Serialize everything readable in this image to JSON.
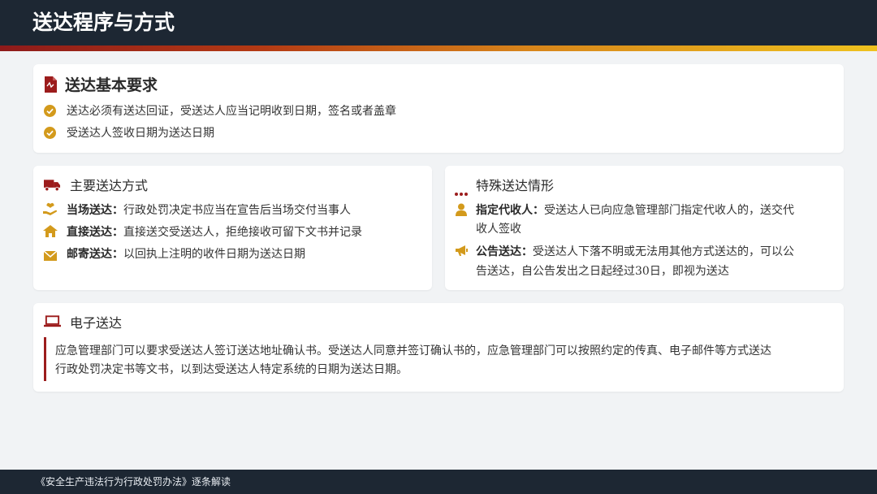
{
  "header": {
    "title": "送达程序与方式"
  },
  "basic": {
    "title": "送达基本要求",
    "items": [
      "送达必须有送达回证，受送达人应当记明收到日期，签名或者盖章",
      "受送达人签收日期为送达日期"
    ]
  },
  "main_methods": {
    "title": "主要送达方式",
    "items": [
      {
        "label": "当场送达：",
        "text": "行政处罚决定书应当在宣告后当场交付当事人"
      },
      {
        "label": "直接送达：",
        "text": "直接送交受送达人，拒绝接收可留下文书并记录"
      },
      {
        "label": "邮寄送达：",
        "text": "以回执上注明的收件日期为送达日期"
      }
    ]
  },
  "special": {
    "title": "特殊送达情形",
    "items": [
      {
        "label": "指定代收人：",
        "line1": "受送达人已向应急管理部门指定代收人的，送交代",
        "line2": "收人签收"
      },
      {
        "label": "公告送达：",
        "line1": "受送达人下落不明或无法用其他方式送达的，可以公",
        "line2": "告送达，自公告发出之日起经过30日，即视为送达"
      }
    ]
  },
  "electronic": {
    "title": "电子送达",
    "line1": "应急管理部门可以要求受送达人签订送达地址确认书。受送达人同意并签订确认书的，应急管理部门可以按照约定的传真、电子邮件等方式送达",
    "line2": "行政处罚决定书等文书，以到达受送达人特定系统的日期为送达日期。"
  },
  "footer": {
    "text": "《安全生产违法行为行政处罚办法》逐条解读"
  },
  "colors": {
    "dark": "#1d2733",
    "red": "#9c1c1c",
    "gold": "#d39a1c"
  },
  "icons": {
    "basic": "document-icon",
    "check": "check-circle-icon",
    "truck": "truck-icon",
    "hand": "hand-heart-icon",
    "home": "home-icon",
    "mail": "envelope-icon",
    "dots": "ellipsis-icon",
    "user": "user-icon",
    "megaphone": "megaphone-icon",
    "laptop": "laptop-icon"
  }
}
